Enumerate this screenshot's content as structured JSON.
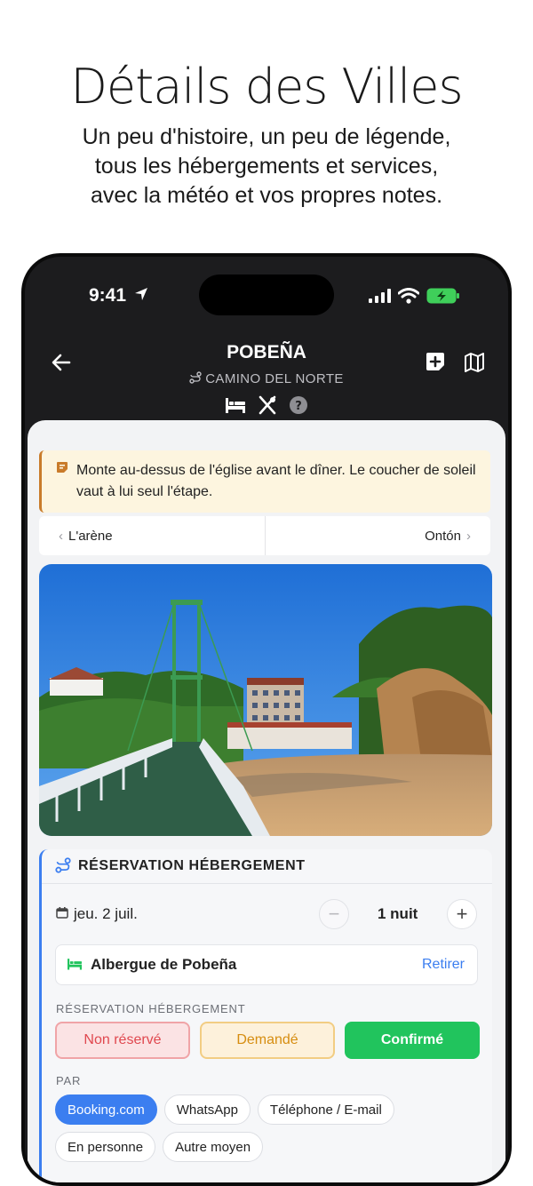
{
  "hero": {
    "title": "Détails des Villes",
    "subtitle_lines": [
      "Un peu d'histoire, un peu de légende,",
      "tous les hébergements et services,",
      "avec la météo et vos propres notes."
    ]
  },
  "status_bar": {
    "time": "9:41"
  },
  "nav": {
    "title": "POBEÑA",
    "route": "CAMINO DEL NORTE"
  },
  "note": {
    "text": "Monte au-dessus de l'église avant le dîner. Le coucher de soleil vaut à lui seul l'étape."
  },
  "prev_next": {
    "prev": "L'arène",
    "next": "Ontón"
  },
  "reservation": {
    "title": "RÉSERVATION HÉBERGEMENT",
    "date": "jeu. 2 juil.",
    "nights": "1 nuit",
    "lodging_name": "Albergue de Pobeña",
    "remove_label": "Retirer",
    "status_label": "RÉSERVATION HÉBERGEMENT",
    "status_options": [
      "Non réservé",
      "Demandé",
      "Confirmé"
    ],
    "selected_status": "Confirmé",
    "via_label": "PAR",
    "via_options": [
      "Booking.com",
      "WhatsApp",
      "Téléphone / E-mail",
      "En personne",
      "Autre moyen"
    ],
    "selected_via": "Booking.com"
  },
  "colors": {
    "accent": "#3b7ef0",
    "confirmed": "#21c45d",
    "note_border": "#c97b2a",
    "dark_header": "#1c1c1e"
  }
}
